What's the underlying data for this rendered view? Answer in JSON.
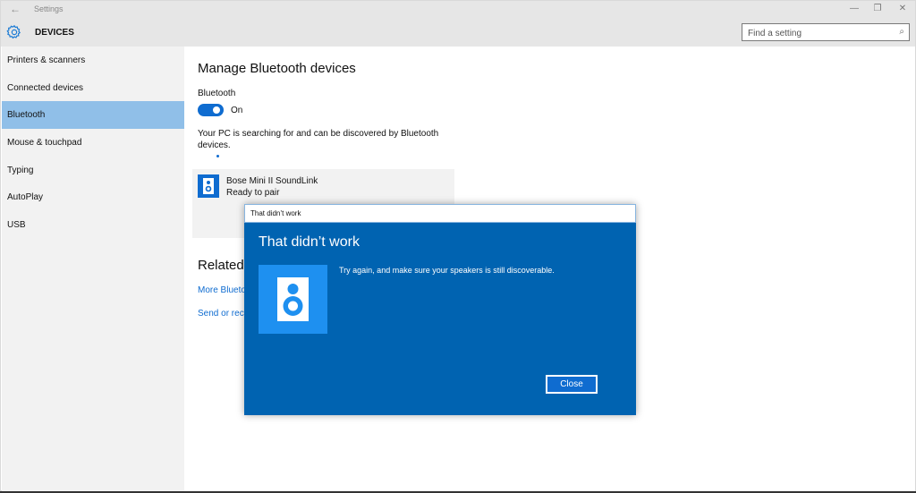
{
  "window": {
    "app_title": "Settings",
    "back_icon": "back-arrow-icon",
    "controls": [
      "minimize",
      "restore",
      "close"
    ],
    "controls_glyphs": [
      "—",
      "❐",
      "✕"
    ]
  },
  "header": {
    "section_icon": "gear-icon",
    "section_title": "DEVICES",
    "search": {
      "placeholder": "Find a setting",
      "value": "",
      "icon": "search-icon"
    }
  },
  "sidebar": {
    "items": [
      {
        "label": "Printers & scanners",
        "active": false
      },
      {
        "label": "Connected devices",
        "active": false
      },
      {
        "label": "Bluetooth",
        "active": true
      },
      {
        "label": "Mouse & touchpad",
        "active": false
      },
      {
        "label": "Typing",
        "active": false
      },
      {
        "label": "AutoPlay",
        "active": false
      },
      {
        "label": "USB",
        "active": false
      }
    ]
  },
  "main": {
    "title": "Manage Bluetooth devices",
    "bluetooth_label": "Bluetooth",
    "toggle_state": "On",
    "description": "Your PC is searching for and can be discovered by Bluetooth devices.",
    "device": {
      "icon": "speaker-icon",
      "name": "Bose Mini II SoundLink",
      "status": "Ready to pair"
    },
    "related_heading": "Related",
    "related_links": [
      "More Blueto",
      "Send or rece"
    ]
  },
  "dialog": {
    "window_title": "That didn’t work",
    "heading": "That didn’t work",
    "icon": "speaker-icon",
    "message": "Try again, and make sure your speakers is still discoverable.",
    "close_label": "Close"
  },
  "colors": {
    "accent": "#0f6cd0",
    "dialog_bg": "#0063b1",
    "dialog_tile": "#1e90f0",
    "sidebar_active": "#90bfe8",
    "sidebar_bg": "#f2f2f2",
    "header_bg": "#e6e6e6"
  }
}
